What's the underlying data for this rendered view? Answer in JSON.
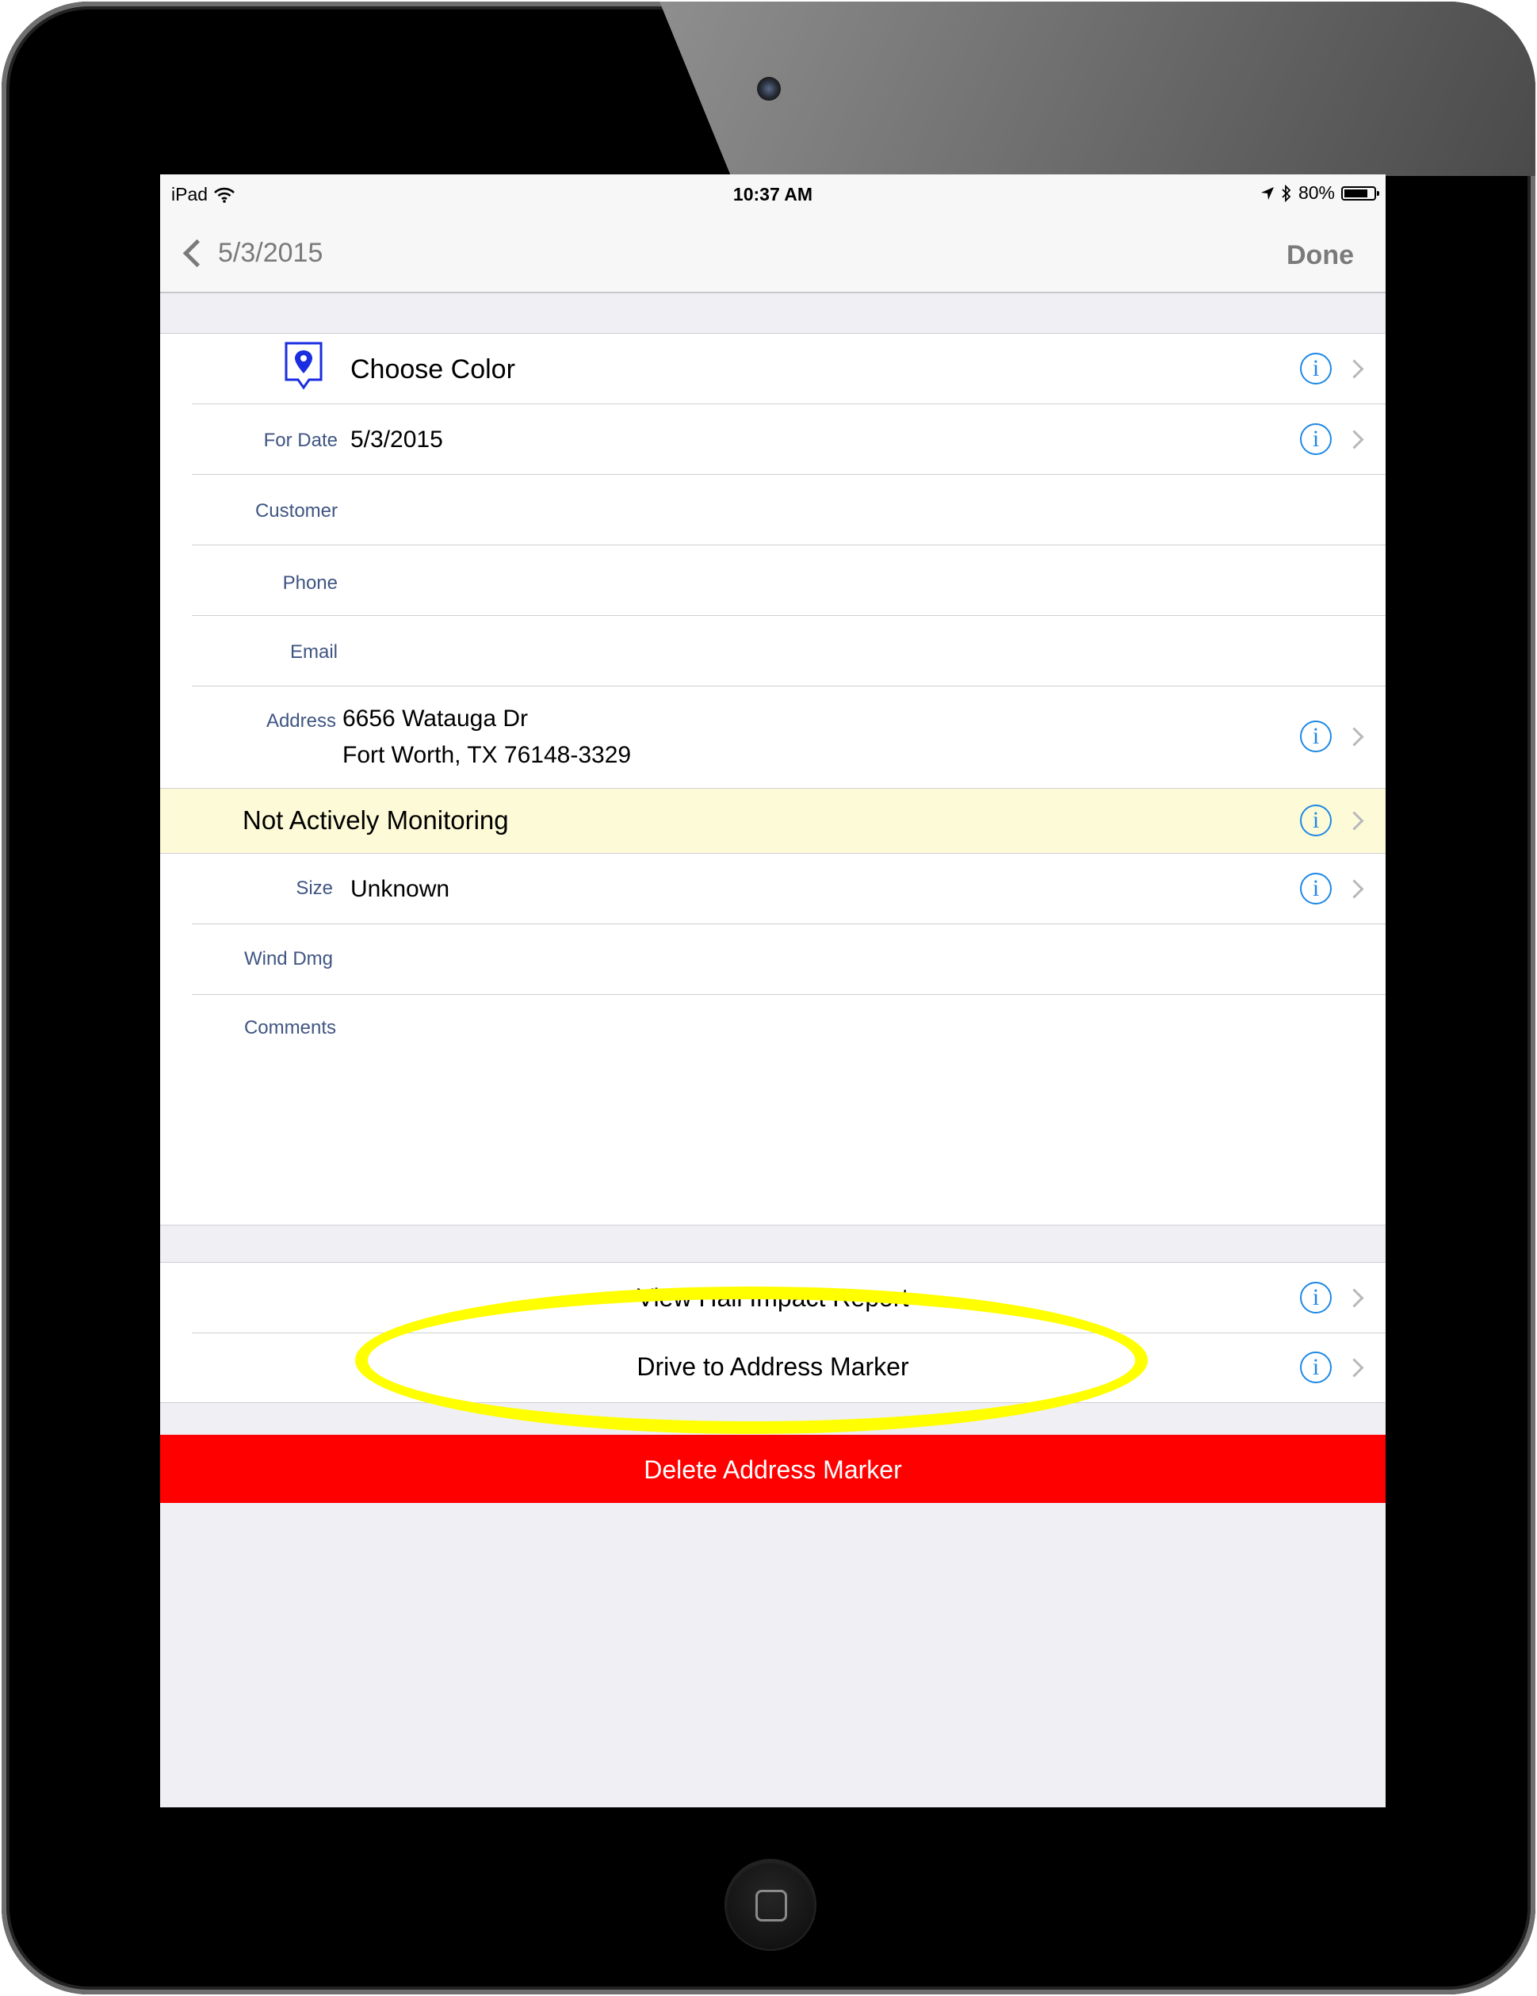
{
  "status_bar": {
    "carrier": "iPad",
    "time": "10:37 AM",
    "battery": "80%",
    "battery_level": 0.8
  },
  "nav": {
    "back_label": "5/3/2015",
    "done_label": "Done"
  },
  "form": {
    "color_label": "Choose Color",
    "for_date_label": "For Date",
    "for_date_value": "5/3/2015",
    "customer_label": "Customer",
    "phone_label": "Phone",
    "email_label": "Email",
    "address_label": "Address",
    "address_line1": "6656 Watauga Dr",
    "address_line2": "Fort Worth, TX 76148-3329",
    "monitoring_status": "Not Actively Monitoring",
    "size_label": "Size",
    "size_value": "Unknown",
    "wind_label": "Wind Dmg",
    "comments_label": "Comments"
  },
  "actions": {
    "view_report": "View Hail Impact Report",
    "drive_to": "Drive to Address Marker",
    "delete": "Delete Address Marker"
  },
  "colors": {
    "accent": "#1e88e5",
    "label": "#3f5582",
    "monitoring_bg": "#fdfbd7",
    "delete_bg": "#ff0000",
    "highlight": "#ffff00",
    "pin": "#1a2de0"
  },
  "icons": {
    "pin": "map-pin-icon",
    "info": "info-circle-icon",
    "disclosure": "chevron-right-icon",
    "wifi": "wifi-icon",
    "location": "location-arrow-icon",
    "bluetooth": "bluetooth-icon"
  }
}
